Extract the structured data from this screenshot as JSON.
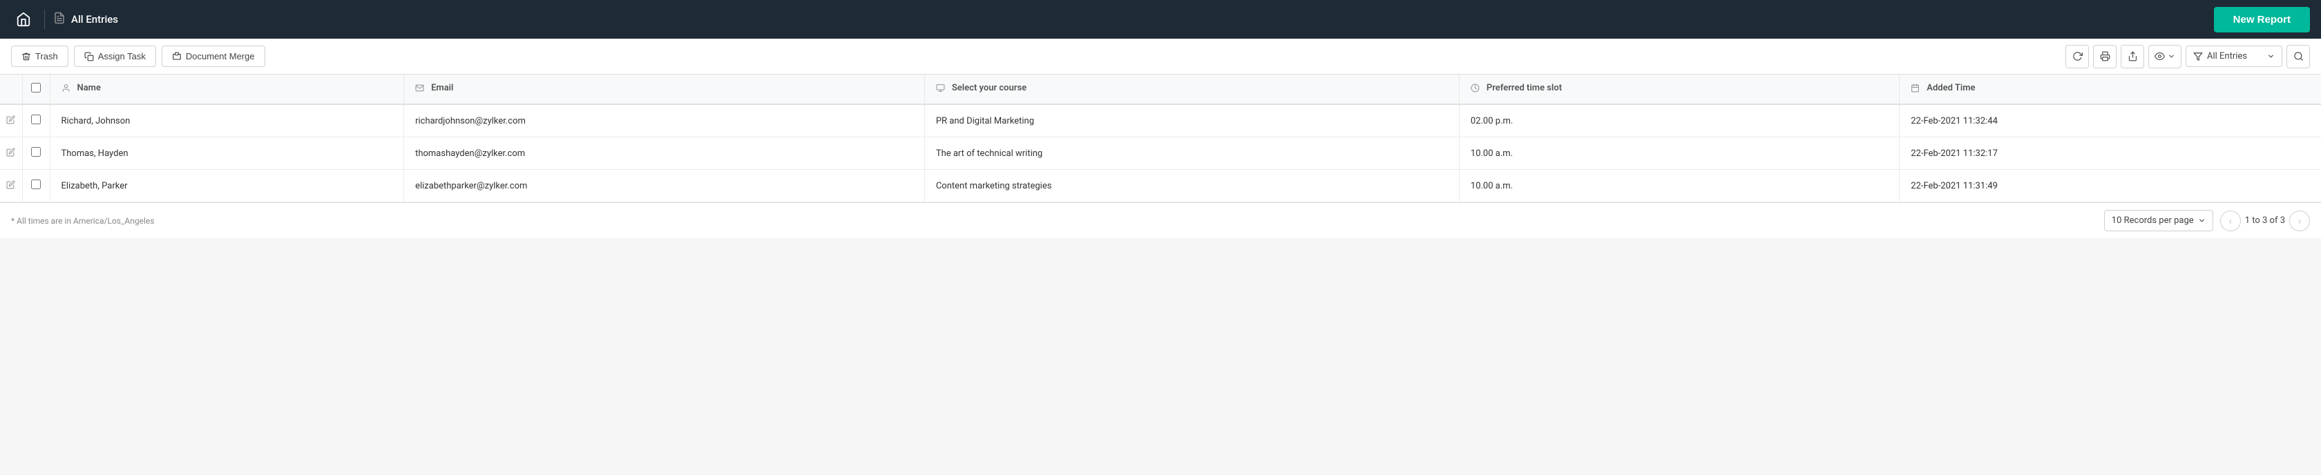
{
  "header": {
    "title": "All Entries",
    "home_icon": "🏠",
    "new_report_label": "New Report"
  },
  "toolbar": {
    "trash_label": "Trash",
    "assign_task_label": "Assign Task",
    "document_merge_label": "Document Merge",
    "filter_label": "All Entries"
  },
  "table": {
    "columns": [
      {
        "id": "name",
        "label": "Name",
        "icon": "person"
      },
      {
        "id": "email",
        "label": "Email",
        "icon": "email"
      },
      {
        "id": "course",
        "label": "Select your course",
        "icon": "course"
      },
      {
        "id": "timeslot",
        "label": "Preferred time slot",
        "icon": "clock"
      },
      {
        "id": "added",
        "label": "Added Time",
        "icon": "calendar"
      }
    ],
    "rows": [
      {
        "name": "Richard, Johnson",
        "email": "richardjohnson@zylker.com",
        "course": "PR and Digital Marketing",
        "timeslot": "02.00 p.m.",
        "added": "22-Feb-2021 11:32:44"
      },
      {
        "name": "Thomas, Hayden",
        "email": "thomashayden@zylker.com",
        "course": "The art of technical writing",
        "timeslot": "10.00 a.m.",
        "added": "22-Feb-2021 11:32:17"
      },
      {
        "name": "Elizabeth, Parker",
        "email": "elizabethparker@zylker.com",
        "course": "Content marketing strategies",
        "timeslot": "10.00 a.m.",
        "added": "22-Feb-2021 11:31:49"
      }
    ]
  },
  "footer": {
    "note": "* All times are in America/Los_Angeles",
    "records_per_page": "10 Records per page",
    "page_info": "1 to 3 of 3"
  }
}
